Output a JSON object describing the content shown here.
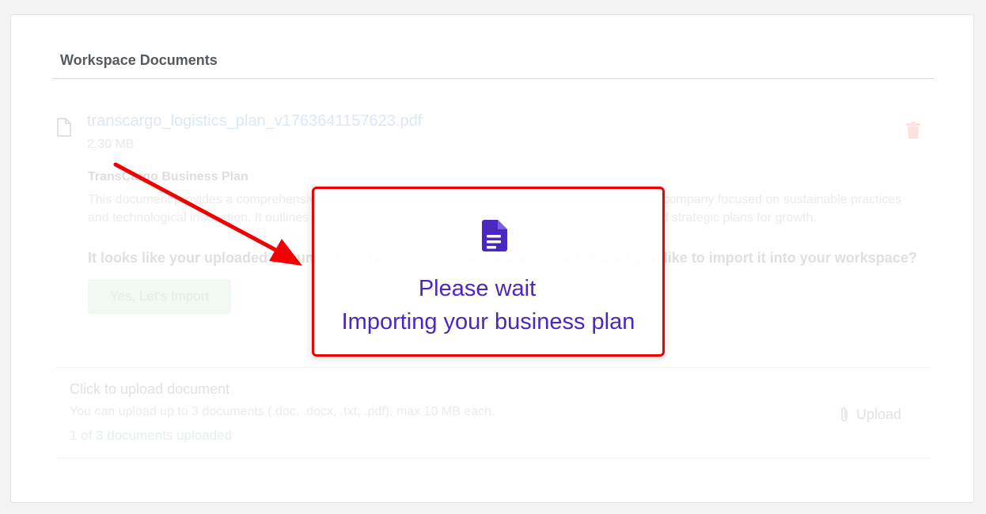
{
  "section": {
    "title": "Workspace Documents"
  },
  "document": {
    "file_name": "transcargo_logistics_plan_v1763641157623.pdf",
    "file_size": "2.30 MB",
    "plan_title": "TransCargo Business Plan",
    "plan_description": "This document provides a comprehensive business plan for TransCargo, a transportation and logistics company focused on sustainable practices and technological innovation. It outlines the company's mission, target market, financial projections, and strategic plans for growth.",
    "import_question": "It looks like your uploaded document contains a complete business plan. Would you like to import it into your workspace?",
    "import_button": "Yes, Let's Import"
  },
  "upload": {
    "title": "Click to upload document",
    "hint": "You can upload up to 3 documents (.doc, .docx, .txt, .pdf), max 10 MB each.",
    "count": "1 of 3 documents uploaded",
    "button": "Upload"
  },
  "modal": {
    "line1": "Please wait",
    "line2": "Importing your business plan"
  },
  "icons": {
    "document": "document-icon",
    "trash": "trash-icon",
    "paperclip": "paperclip-icon",
    "modal": "document-text-icon"
  },
  "colors": {
    "accent_purple": "#4b27c2",
    "highlight_red": "#f00000",
    "link_blue_faded": "#dde8f7",
    "delete_red_faded": "#fde1e1"
  }
}
